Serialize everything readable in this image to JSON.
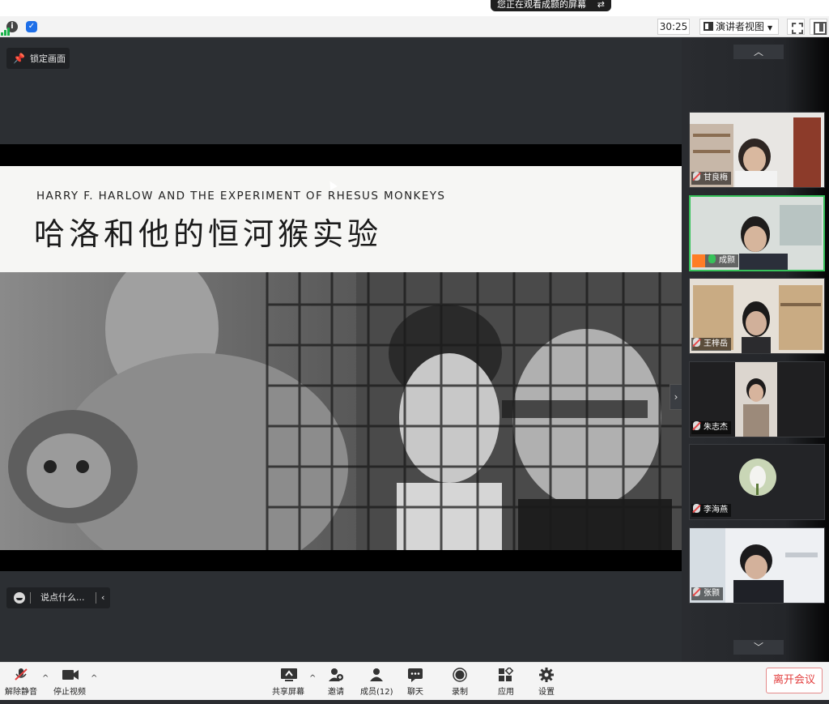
{
  "banner": {
    "share_text": "您正在观看成颢的屏幕",
    "switch_icon": "switch-icon"
  },
  "status_bar": {
    "info_icon": "info-icon",
    "shield_icon": "shield-icon",
    "signal_icon": "signal-icon",
    "timer": "30:25",
    "view_mode": "演讲者视图",
    "fullscreen_icon": "fullscreen-icon",
    "sidebar_icon": "sidebar-toggle-icon"
  },
  "share": {
    "lock_label": "锁定画面",
    "slide": {
      "subtitle": "HARRY F. HARLOW AND THE EXPERIMENT OF RHESUS MONKEYS",
      "title": "哈洛和他的恒河猴实验"
    },
    "chat_placeholder": "说点什么..."
  },
  "participants": [
    {
      "name": "甘良梅",
      "mic": "muted",
      "host": false,
      "active": false
    },
    {
      "name": "成颢",
      "mic": "on",
      "host": true,
      "active": true
    },
    {
      "name": "王梓岳",
      "mic": "muted",
      "host": false,
      "active": false
    },
    {
      "name": "朱志杰",
      "mic": "muted",
      "host": false,
      "active": false
    },
    {
      "name": "李海燕",
      "mic": "muted",
      "host": false,
      "active": false
    },
    {
      "name": "张颢",
      "mic": "muted",
      "host": false,
      "active": false
    }
  ],
  "toolbar": {
    "unmute": "解除静音",
    "stop_video": "停止视频",
    "share_screen": "共享屏幕",
    "invite": "邀请",
    "members": "成员(12)",
    "chat": "聊天",
    "record": "录制",
    "apps": "应用",
    "settings": "设置",
    "leave": "离开会议"
  },
  "colors": {
    "accent_green": "#37c25a",
    "leave_red": "#e23d3d",
    "host_orange": "#ff7d26"
  }
}
